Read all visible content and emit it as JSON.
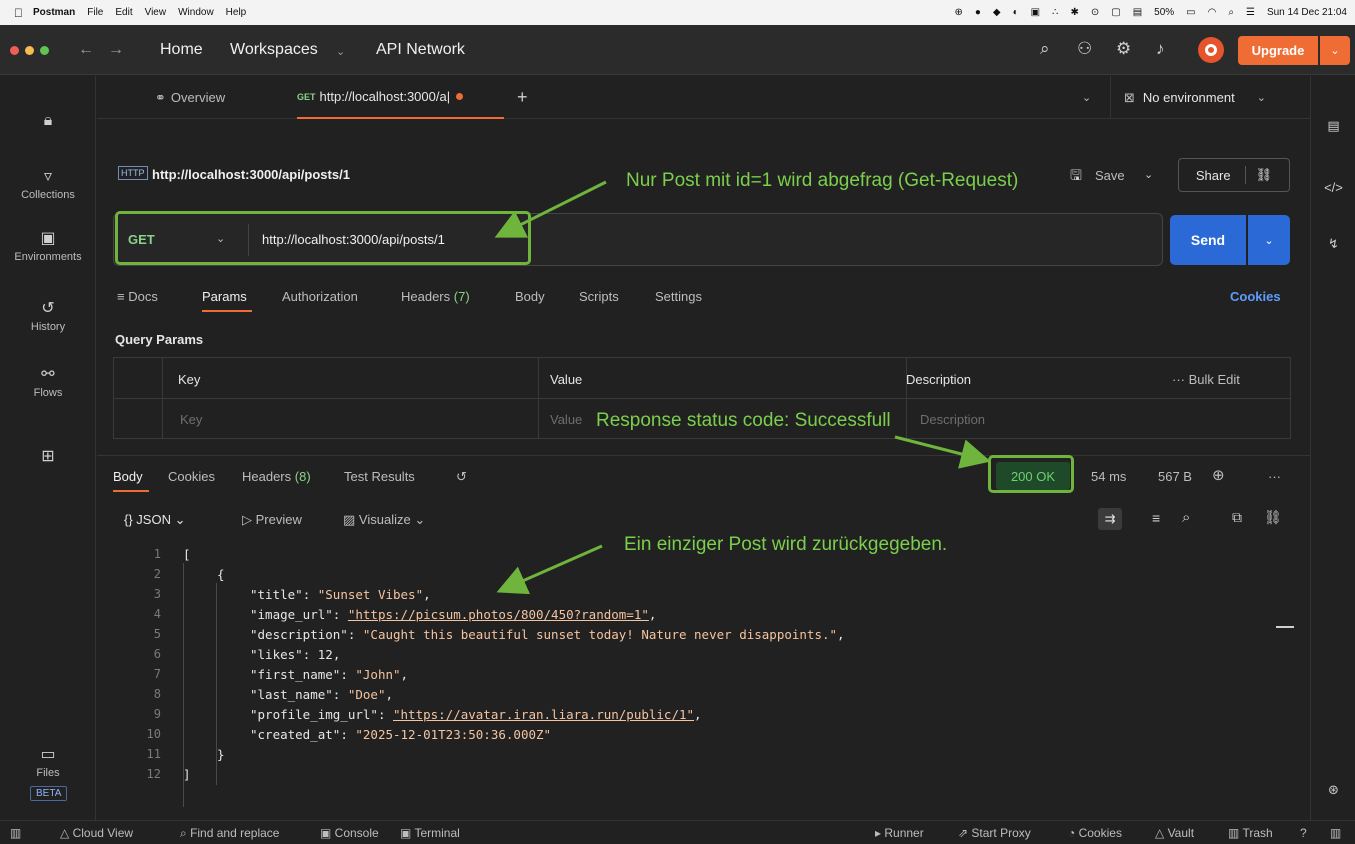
{
  "menubar": {
    "app": "Postman",
    "items": [
      "File",
      "Edit",
      "View",
      "Window",
      "Help"
    ],
    "battery": "50%",
    "clock": "Sun 14 Dec 21:04"
  },
  "titlebar": {
    "home": "Home",
    "workspaces": "Workspaces",
    "api_network": "API Network",
    "upgrade": "Upgrade"
  },
  "sidebar": {
    "collections": "Collections",
    "environments": "Environments",
    "history": "History",
    "flows": "Flows",
    "files": "Files",
    "beta": "BETA"
  },
  "tabs": {
    "overview": "Overview",
    "active_method": "GET",
    "active_url": "http://localhost:3000/a|",
    "environment": "No environment"
  },
  "request": {
    "title": "http://localhost:3000/api/posts/1",
    "save": "Save",
    "share": "Share",
    "method": "GET",
    "url": "http://localhost:3000/api/posts/1",
    "send": "Send"
  },
  "request_tabs": {
    "docs": "Docs",
    "params": "Params",
    "authorization": "Authorization",
    "headers": "Headers",
    "headers_count": "(7)",
    "body": "Body",
    "scripts": "Scripts",
    "settings": "Settings",
    "cookies": "Cookies"
  },
  "query_params": {
    "label": "Query Params",
    "col_key": "Key",
    "col_value": "Value",
    "col_description": "Description",
    "bulk_edit": "Bulk Edit",
    "ph_key": "Key",
    "ph_value": "Value",
    "ph_description": "Description"
  },
  "response": {
    "body": "Body",
    "cookies": "Cookies",
    "headers": "Headers",
    "headers_count": "(8)",
    "test_results": "Test Results",
    "status": "200 OK",
    "time": "54 ms",
    "size": "567 B",
    "format": "JSON",
    "preview": "Preview",
    "visualize": "Visualize"
  },
  "code": {
    "line_numbers": [
      "1",
      "2",
      "3",
      "4",
      "5",
      "6",
      "7",
      "8",
      "9",
      "10",
      "11",
      "12"
    ],
    "title_key": "\"title\"",
    "title_val": "\"Sunset Vibes\"",
    "image_key": "\"image_url\"",
    "image_val": "\"https://picsum.photos/800/450?random=1\"",
    "desc_key": "\"description\"",
    "desc_val": "\"Caught this beautiful sunset today! Nature never disappoints.\"",
    "likes_key": "\"likes\"",
    "likes_val": "12",
    "first_key": "\"first_name\"",
    "first_val": "\"John\"",
    "last_key": "\"last_name\"",
    "last_val": "\"Doe\"",
    "profile_key": "\"profile_img_url\"",
    "profile_val": "\"https://avatar.iran.liara.run/public/1\"",
    "created_key": "\"created_at\"",
    "created_val": "\"2025-12-01T23:50:36.000Z\""
  },
  "annotations": {
    "a1": "Nur Post mit id=1 wird abgefrag (Get-Request)",
    "a2": "Response status code: Successfull",
    "a3": "Ein einziger Post wird zurückgegeben."
  },
  "bottombar": {
    "cloud_view": "Cloud View",
    "find_replace": "Find and replace",
    "console": "Console",
    "terminal": "Terminal",
    "runner": "Runner",
    "start_proxy": "Start Proxy",
    "cookies": "Cookies",
    "vault": "Vault",
    "trash": "Trash"
  },
  "colors": {
    "accent_orange": "#ef6c35",
    "send_blue": "#2a69d6",
    "annotation_green": "#6fb43c",
    "method_green": "#8ad28a"
  }
}
